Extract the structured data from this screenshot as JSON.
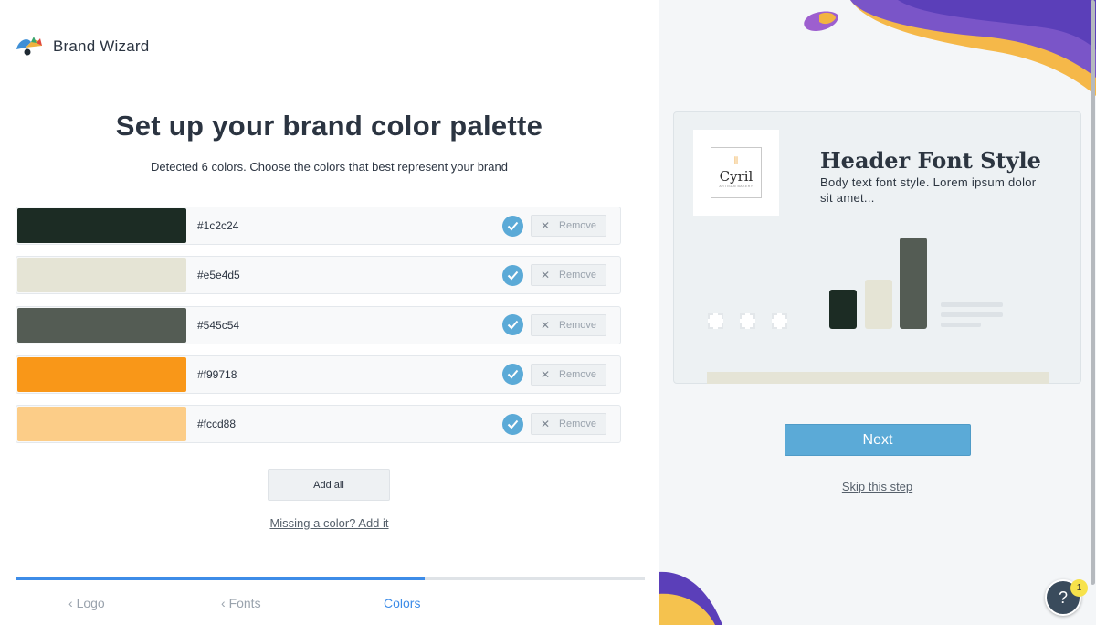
{
  "app": {
    "name": "Brand Wizard"
  },
  "page": {
    "title": "Set up your brand color palette",
    "subtitle": "Detected 6 colors. Choose the colors that best represent your brand"
  },
  "colors": [
    {
      "hex": "#1c2c24",
      "selected": true,
      "remove_label": "Remove"
    },
    {
      "hex": "#e5e4d5",
      "selected": true,
      "remove_label": "Remove"
    },
    {
      "hex": "#545c54",
      "selected": true,
      "remove_label": "Remove"
    },
    {
      "hex": "#f99718",
      "selected": true,
      "remove_label": "Remove"
    },
    {
      "hex": "#fccd88",
      "selected": true,
      "remove_label": "Remove"
    }
  ],
  "actions": {
    "add_all": "Add all",
    "missing_color": "Missing a color? Add it",
    "next": "Next",
    "skip": "Skip this step"
  },
  "steps": [
    {
      "label": "Logo",
      "chevron": "‹",
      "active": false
    },
    {
      "label": "Fonts",
      "chevron": "‹",
      "active": false
    },
    {
      "label": "Colors",
      "chevron": "",
      "active": true
    }
  ],
  "progress": 0.65,
  "preview": {
    "logo_text": "Cyril",
    "logo_subtext": "ARTISAN BAKERY",
    "header_font_text": "Header Font Style",
    "body_font_text": "Body text font style. Lorem ipsum dolor sit amet...",
    "bars": [
      {
        "color": "#1c2c24",
        "level": 0.43
      },
      {
        "color": "#e5e4d5",
        "level": 0.54
      },
      {
        "color": "#545c54",
        "level": 1.0
      }
    ]
  },
  "help": {
    "label": "?",
    "badge_count": "1"
  },
  "theme": {
    "accent": "#5baad7",
    "progress_color": "#3d8ce8"
  }
}
